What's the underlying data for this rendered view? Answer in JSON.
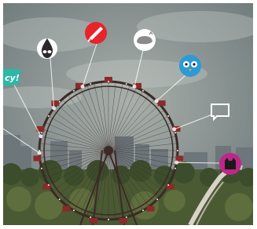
{
  "scene": {
    "caption": "",
    "icons": [
      {
        "name": "nyc-sticker-icon",
        "text": "cy!",
        "color": "#2bb8a5"
      },
      {
        "name": "drop-face-icon",
        "color": "#ffffff"
      },
      {
        "name": "red-pen-icon",
        "color": "#e8232a"
      },
      {
        "name": "whale-icon",
        "color": "#ffffff"
      },
      {
        "name": "blue-bird-icon",
        "color": "#2a9bd6"
      },
      {
        "name": "speech-bubble-icon",
        "color": "#ffffff"
      },
      {
        "name": "pink-cat-icon",
        "color": "#c0268a"
      }
    ],
    "colors": {
      "sky": "#8a9596",
      "wheel": "#3b2a26",
      "cabin": "#8a2a2a",
      "trees": "#4a5a33"
    }
  }
}
